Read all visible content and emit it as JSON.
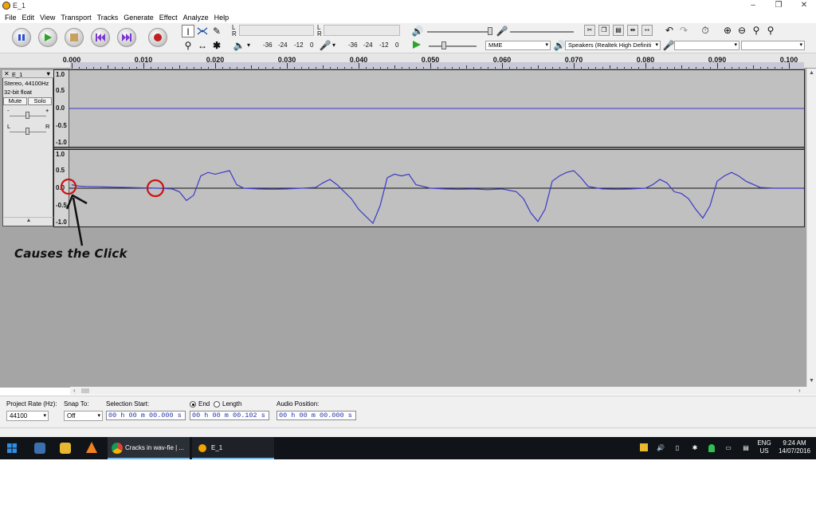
{
  "window": {
    "title": "E_1",
    "minimize": "–",
    "restore": "❐",
    "close": "✕"
  },
  "menu": [
    "File",
    "Edit",
    "View",
    "Transport",
    "Tracks",
    "Generate",
    "Effect",
    "Analyze",
    "Help"
  ],
  "meters": {
    "rec_lr_top": "L",
    "rec_lr_bot": "R",
    "play_lr_top": "L",
    "play_lr_bot": "R",
    "rec_scale": [
      "-36",
      "-24",
      "-12",
      "0"
    ],
    "play_scale": [
      "-36",
      "-24",
      "-12",
      "0"
    ]
  },
  "devices": {
    "host": "MME",
    "output": "Speakers (Realtek High Definiti",
    "input": ""
  },
  "ruler": {
    "labels": [
      "0.000",
      "0.010",
      "0.020",
      "0.030",
      "0.040",
      "0.050",
      "0.060",
      "0.070",
      "0.080",
      "0.090",
      "0.100"
    ]
  },
  "track": {
    "name": "E_1",
    "close": "✕",
    "info1": "Stereo, 44100Hz",
    "info2": "32-bit float",
    "mute": "Mute",
    "solo": "Solo",
    "gain_minus": "-",
    "gain_plus": "+",
    "pan_left": "L",
    "pan_right": "R",
    "collapse": "▲"
  },
  "vruler": {
    "top": [
      "1.0",
      "0.5",
      "0.0",
      "-0.5",
      "-1.0"
    ],
    "bottom": [
      "1.0",
      "0.5",
      "0.0",
      "-0.5",
      "-1.0"
    ]
  },
  "waveform": {
    "color": "#3a3ac8",
    "channel2_times": [
      0.0,
      0.001,
      0.002,
      0.004,
      0.006,
      0.008,
      0.01,
      0.012,
      0.014,
      0.015,
      0.016,
      0.017,
      0.018,
      0.019,
      0.02,
      0.021,
      0.022,
      0.023,
      0.024,
      0.026,
      0.028,
      0.03,
      0.032,
      0.034,
      0.035,
      0.036,
      0.037,
      0.038,
      0.039,
      0.04,
      0.041,
      0.042,
      0.043,
      0.044,
      0.045,
      0.046,
      0.047,
      0.048,
      0.05,
      0.052,
      0.054,
      0.056,
      0.058,
      0.06,
      0.062,
      0.063,
      0.064,
      0.065,
      0.066,
      0.067,
      0.068,
      0.069,
      0.07,
      0.071,
      0.072,
      0.074,
      0.076,
      0.078,
      0.08,
      0.081,
      0.082,
      0.083,
      0.084,
      0.085,
      0.086,
      0.087,
      0.088,
      0.089,
      0.09,
      0.091,
      0.092,
      0.093,
      0.094,
      0.096,
      0.098,
      0.1,
      0.102
    ],
    "channel2_values": [
      0.1,
      0.06,
      0.05,
      0.04,
      0.03,
      0.02,
      0.01,
      0.0,
      -0.02,
      -0.1,
      -0.35,
      -0.2,
      0.35,
      0.45,
      0.4,
      0.45,
      0.5,
      0.1,
      0.0,
      -0.02,
      -0.03,
      -0.02,
      0.0,
      0.02,
      0.15,
      0.25,
      0.1,
      -0.1,
      -0.3,
      -0.6,
      -0.8,
      -1.0,
      -0.5,
      0.3,
      0.4,
      0.35,
      0.4,
      0.1,
      0.0,
      -0.02,
      -0.03,
      -0.02,
      -0.04,
      -0.02,
      -0.1,
      -0.3,
      -0.7,
      -0.95,
      -0.6,
      0.2,
      0.35,
      0.45,
      0.5,
      0.3,
      0.05,
      -0.02,
      -0.03,
      -0.02,
      0.0,
      0.1,
      0.25,
      0.15,
      -0.1,
      -0.15,
      -0.3,
      -0.6,
      -0.85,
      -0.5,
      0.2,
      0.35,
      0.45,
      0.35,
      0.2,
      0.02,
      0.0,
      0.0,
      0.0
    ]
  },
  "annotation": {
    "text": "Causes the Click",
    "color": "#d01010"
  },
  "selection_toolbar": {
    "project_rate_label": "Project Rate (Hz):",
    "project_rate_value": "44100",
    "snap_label": "Snap To:",
    "snap_value": "Off",
    "selection_start_label": "Selection Start:",
    "selection_start_value": "00 h 00 m 00.000 s",
    "end_label": "End",
    "length_label": "Length",
    "end_value": "00 h 00 m 00.102 s",
    "audio_position_label": "Audio Position:",
    "audio_position_value": "00 h 00 m 00.000 s"
  },
  "taskbar": {
    "chrome_label": "Cracks in wav-fie | ...",
    "audacity_label": "E_1",
    "lang1": "ENG",
    "lang2": "US",
    "time": "9:24 AM",
    "date": "14/07/2016"
  }
}
